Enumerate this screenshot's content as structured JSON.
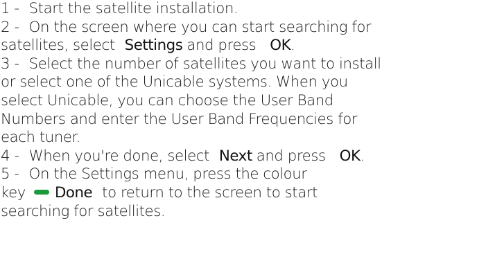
{
  "instructions": {
    "line1": {
      "num": "1 -",
      "text": "Start the satellite installation."
    },
    "line2": {
      "num": "2 -",
      "text": "On the screen where you can start searching for"
    },
    "line3": {
      "pre": "satellites, select",
      "kw1": "Settings",
      "mid": "and press",
      "kw2": "OK",
      "post": "."
    },
    "line4": {
      "num": "3 -",
      "text": "Select the number of satellites you want to install"
    },
    "line5": {
      "text": "or select one of the Unicable systems. When you"
    },
    "line6": {
      "text": "select Unicable, you can choose the User Band"
    },
    "line7": {
      "text": "Numbers and enter the User Band Frequencies for"
    },
    "line8": {
      "text": "each tuner."
    },
    "line9": {
      "num": "4 -",
      "pre": "When you're done, select",
      "kw1": "Next",
      "mid": "and press",
      "kw2": "OK",
      "post": "."
    },
    "line10": {
      "num": "5 -",
      "text": "On the Settings menu, press the colour"
    },
    "line11": {
      "pre": "key",
      "key_label": "Done",
      "post": "to return to the screen to start"
    },
    "line12": {
      "text": "searching for satellites."
    }
  },
  "colors": {
    "green_key": "#1a9a3c",
    "text": "#1a1a1a"
  },
  "icons": {
    "colour_key": "green-colour-key-icon"
  }
}
